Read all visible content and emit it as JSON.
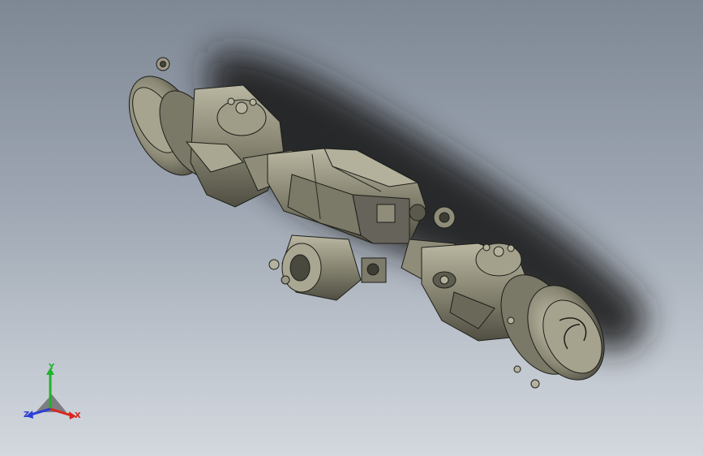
{
  "viewport": {
    "background_top": "#7e8794",
    "background_bottom": "#d3d8de"
  },
  "model": {
    "part_color": "#8c8a76",
    "edge_color": "#1e1e1a",
    "shadow_color": "#1c1c1c"
  },
  "triad": {
    "x_label": "X",
    "y_label": "Y",
    "z_label": "Z",
    "x_color": "#d8271d",
    "y_color": "#1fb32a",
    "z_color": "#2c3ed8"
  }
}
